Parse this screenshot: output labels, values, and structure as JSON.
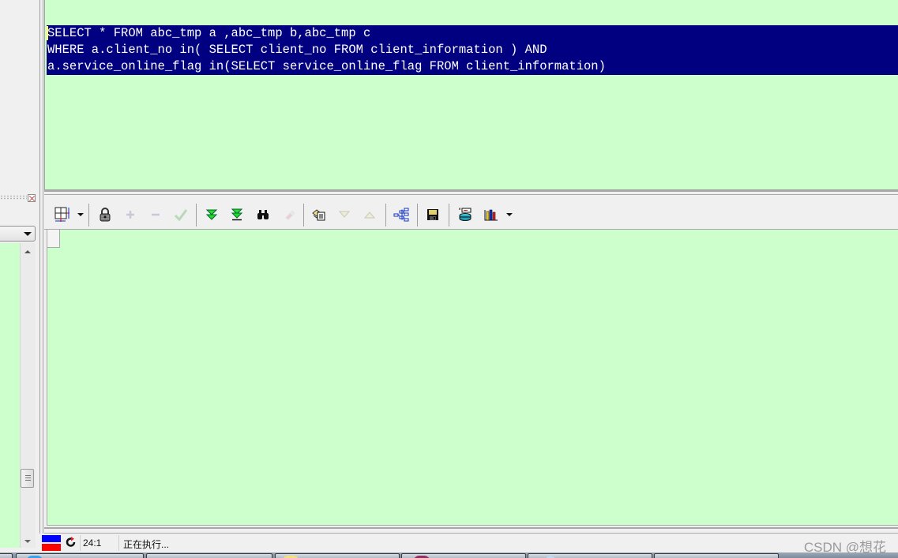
{
  "editor": {
    "sql_lines": [
      "SELECT * FROM abc_tmp a ,abc_tmp b,abc_tmp c",
      "WHERE a.client_no in( SELECT client_no FROM client_information ) AND",
      "a.service_online_flag in(SELECT service_online_flag FROM client_information)"
    ],
    "selection_color": "#000080",
    "background_color": "#ccffcc"
  },
  "toolbar": {
    "buttons": [
      {
        "name": "grid-layout",
        "icon": "grid-icon",
        "enabled": true,
        "has_dropdown": true
      },
      {
        "name": "lock",
        "icon": "lock-icon",
        "enabled": true
      },
      {
        "name": "insert-record",
        "icon": "plus-icon",
        "enabled": false
      },
      {
        "name": "delete-record",
        "icon": "minus-icon",
        "enabled": false
      },
      {
        "name": "post-changes",
        "icon": "check-icon",
        "enabled": false
      },
      {
        "name": "fetch-next-page",
        "icon": "double-down-icon",
        "enabled": true
      },
      {
        "name": "fetch-last-page",
        "icon": "double-down-bar-icon",
        "enabled": true
      },
      {
        "name": "find",
        "icon": "binoculars-icon",
        "enabled": true
      },
      {
        "name": "clear-record",
        "icon": "eraser-icon",
        "enabled": false
      },
      {
        "name": "single-record-view",
        "icon": "record-view-icon",
        "enabled": true
      },
      {
        "name": "next-record",
        "icon": "triangle-down-icon",
        "enabled": false
      },
      {
        "name": "previous-record",
        "icon": "triangle-up-icon",
        "enabled": false
      },
      {
        "name": "query-plan",
        "icon": "tree-icon",
        "enabled": true
      },
      {
        "name": "export",
        "icon": "floppy-disk-icon",
        "enabled": true
      },
      {
        "name": "export-database",
        "icon": "database-icon",
        "enabled": true
      },
      {
        "name": "chart",
        "icon": "bar-chart-icon",
        "enabled": true,
        "has_dropdown": true
      }
    ]
  },
  "statusbar": {
    "cursor_position": "24:1",
    "message": "正在执行..."
  },
  "watermark": "CSDN @想花"
}
